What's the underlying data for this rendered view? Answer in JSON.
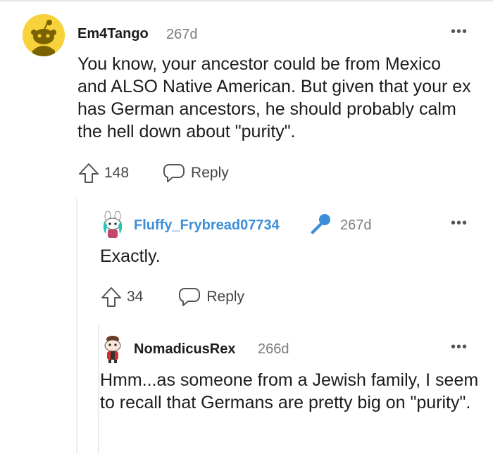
{
  "comments": [
    {
      "username": "Em4Tango",
      "age": "267d",
      "text": "You know, your ancestor could be from Mexico and ALSO Native American. But given that your ex has German ancestors, he should probably calm the hell down about \"purity\".",
      "votes": "148",
      "reply_label": "Reply",
      "more_label": "•••",
      "avatar_icon": "reddit-snoo-icon",
      "avatar_color": "#f7d23a"
    },
    {
      "username": "Fluffy_Frybread07734",
      "age": "267d",
      "text": "Exactly.",
      "votes": "34",
      "reply_label": "Reply",
      "more_label": "•••",
      "avatar_icon": "snoo-avatar-icon",
      "badge_icon": "microphone-icon",
      "username_color": "#3b8fd9"
    },
    {
      "username": "NomadicusRex",
      "age": "266d",
      "text": "Hmm...as someone from a Jewish family, I seem to recall that Germans are pretty big on \"purity\".",
      "more_label": "•••",
      "avatar_icon": "snoo-avatar-icon"
    }
  ]
}
